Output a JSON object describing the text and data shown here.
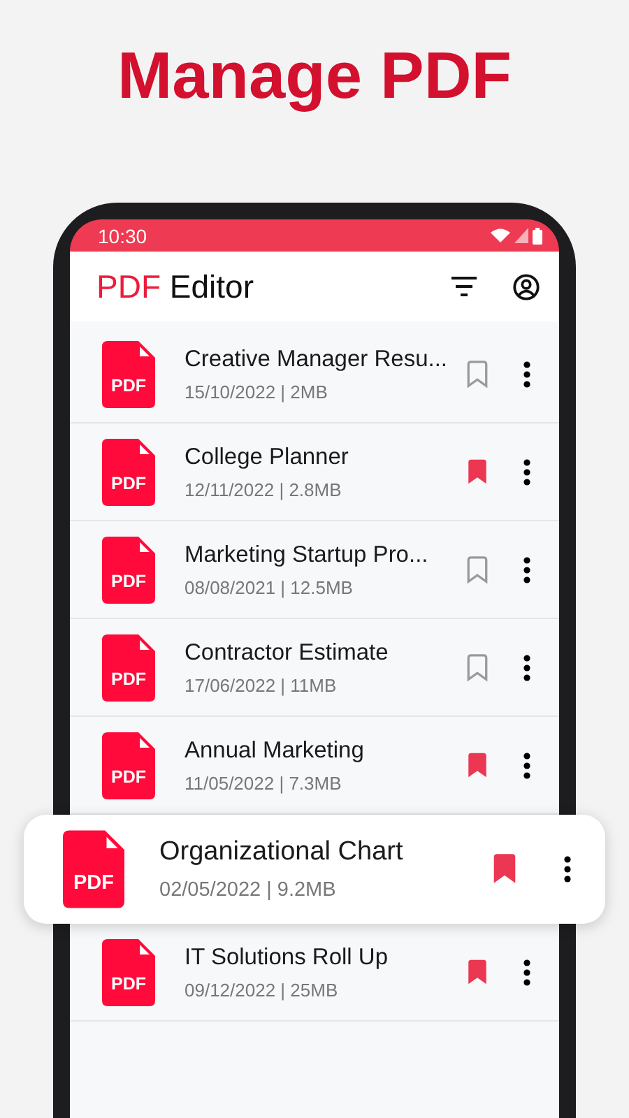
{
  "headline": "Manage PDF",
  "status_bar": {
    "time": "10:30"
  },
  "app_bar": {
    "title_accent": "PDF",
    "title": "Editor"
  },
  "files": [
    {
      "kind": "row",
      "icon_label": "PDF",
      "name": "Creative Manager Resu...",
      "details": "15/10/2022 | 2MB",
      "bookmarked": false
    },
    {
      "kind": "row",
      "icon_label": "PDF",
      "name": "College Planner",
      "details": "12/11/2022 | 2.8MB",
      "bookmarked": true
    },
    {
      "kind": "row",
      "icon_label": "PDF",
      "name": "Marketing Startup Pro...",
      "details": "08/08/2021 | 12.5MB",
      "bookmarked": false
    },
    {
      "kind": "row",
      "icon_label": "PDF",
      "name": "Contractor Estimate",
      "details": "17/06/2022 | 11MB",
      "bookmarked": false
    },
    {
      "kind": "row",
      "icon_label": "PDF",
      "name": "Annual Marketing",
      "details": "11/05/2022 | 7.3MB",
      "bookmarked": true
    },
    {
      "kind": "lifted",
      "icon_label": "PDF",
      "name": "Organizational Chart",
      "details": "02/05/2022 | 9.2MB",
      "bookmarked": true
    },
    {
      "kind": "row",
      "icon_label": "PDF",
      "name": "IT Solutions Roll Up",
      "details": "09/12/2022 | 25MB",
      "bookmarked": true
    }
  ]
}
